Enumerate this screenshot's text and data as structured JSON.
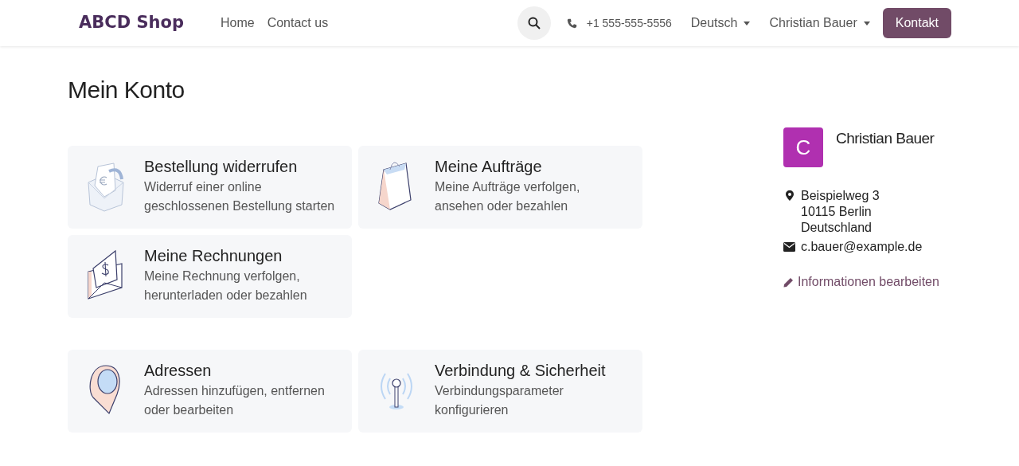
{
  "navbar": {
    "brand": "ABCD Shop",
    "links": [
      "Home",
      "Contact us"
    ],
    "phone": "+1 555-555-5556",
    "language": "Deutsch",
    "user": "Christian Bauer",
    "cta": "Kontakt"
  },
  "page": {
    "title": "Mein Konto"
  },
  "groups": [
    {
      "cards": [
        {
          "kind": "refund",
          "title": "Bestellung widerrufen",
          "text": "Widerruf einer online geschlossenen Bestellung starten"
        },
        {
          "kind": "bag",
          "title": "Meine Aufträge",
          "text": "Meine Aufträge verfolgen, ansehen oder bezahlen"
        },
        {
          "kind": "invoice",
          "title": "Meine Rechnungen",
          "text": "Meine Rechnung verfolgen, herunterladen oder bezahlen"
        }
      ]
    },
    {
      "cards": [
        {
          "kind": "pin",
          "title": "Adressen",
          "text": "Adressen hinzufügen, entfernen oder bearbeiten"
        },
        {
          "kind": "signal",
          "title": "Verbindung & Sicherheit",
          "text": "Verbindungsparameter konfigurieren"
        }
      ]
    }
  ],
  "profile": {
    "initial": "C",
    "name": "Christian Bauer",
    "address": [
      "Beispielweg 3",
      "10115 Berlin",
      "Deutschland"
    ],
    "email": "c.bauer@example.de",
    "edit_link": "Informationen bearbeiten"
  }
}
